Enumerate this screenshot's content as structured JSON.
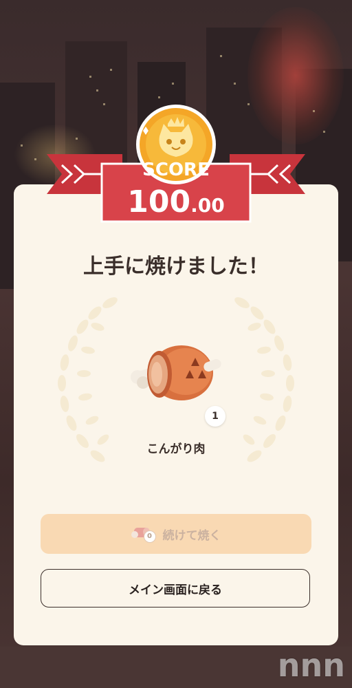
{
  "score": {
    "label": "SCORE",
    "value_int": "100",
    "value_dec": ".00"
  },
  "result": {
    "title": "上手に焼けました！",
    "item_name": "こんがり肉",
    "item_qty": "1",
    "item_icon": "well-done-meat-icon"
  },
  "buttons": {
    "continue_label": "続けて焼く",
    "continue_ticket_count": "0",
    "main_menu_label": "メイン画面に戻る"
  },
  "watermark": "nnn",
  "colors": {
    "ribbon_red": "#d8434a",
    "medal_gold": "#f4a627",
    "card_bg": "#fbf5ea",
    "continue_btn": "#f9d9b3"
  }
}
